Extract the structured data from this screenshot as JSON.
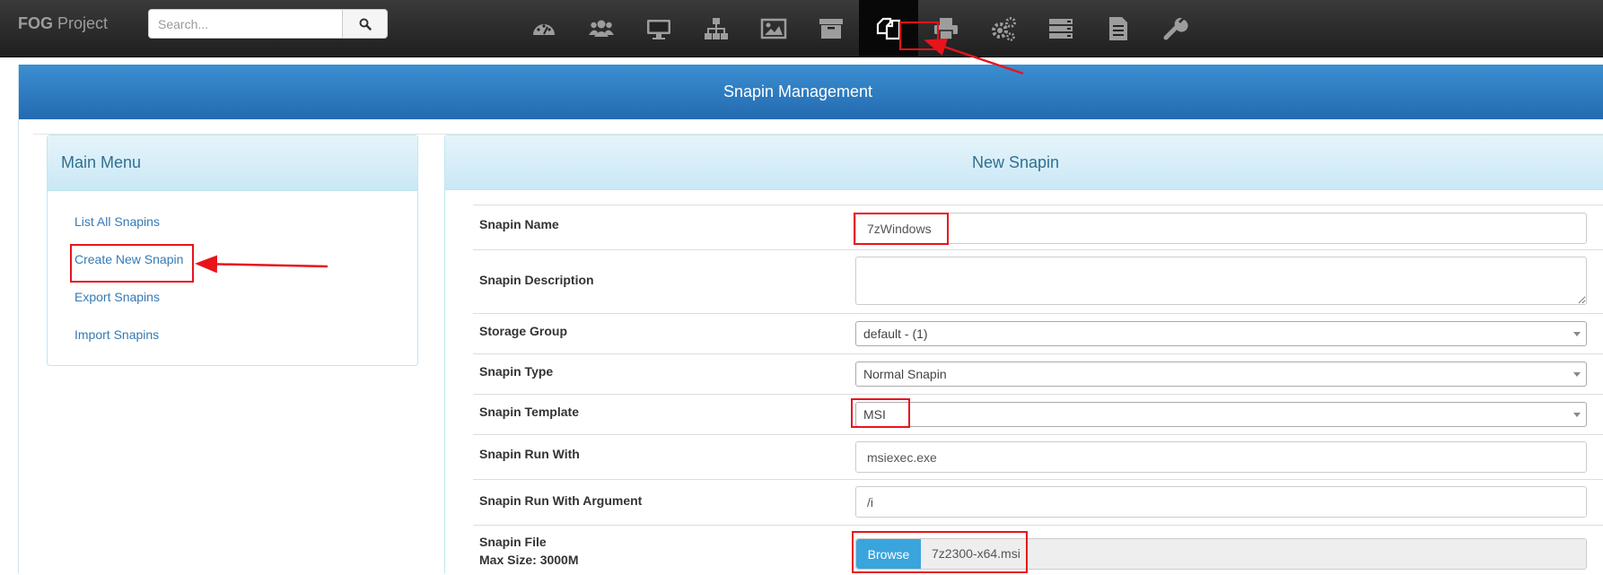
{
  "brand": {
    "bold": "FOG",
    "rest": " Project"
  },
  "search": {
    "placeholder": "Search..."
  },
  "nav_icons": [
    "dashboard-icon",
    "users-icon",
    "hosts-icon",
    "groups-icon",
    "images-icon",
    "storage-icon",
    "snapins-icon",
    "printers-icon",
    "services-icon",
    "tasks-icon",
    "reports-icon",
    "settings-icon"
  ],
  "active_nav": "snapins-icon",
  "page_title": "Snapin Management",
  "menu": {
    "title": "Main Menu",
    "items": [
      "List All Snapins",
      "Create New Snapin",
      "Export Snapins",
      "Import Snapins"
    ]
  },
  "form": {
    "title": "New Snapin",
    "snapin_name": {
      "label": "Snapin Name",
      "value": "7zWindows"
    },
    "snapin_description": {
      "label": "Snapin Description",
      "value": ""
    },
    "storage_group": {
      "label": "Storage Group",
      "value": "default - (1)"
    },
    "snapin_type": {
      "label": "Snapin Type",
      "value": "Normal Snapin"
    },
    "snapin_template": {
      "label": "Snapin Template",
      "value": "MSI"
    },
    "run_with": {
      "label": "Snapin Run With",
      "value": "msiexec.exe"
    },
    "run_with_argument": {
      "label": "Snapin Run With Argument",
      "value": "/i"
    },
    "snapin_file": {
      "label": "Snapin File",
      "sublabel": "Max Size: 3000M",
      "browse_label": "Browse",
      "file_name": "7z2300-x64.msi"
    }
  },
  "colors": {
    "navbar": "#222222",
    "header": "#337ab7",
    "panel_heading": "#d9edf7",
    "link": "#337ab7",
    "highlight": "#e8141b",
    "browse": "#3aa4dc"
  }
}
